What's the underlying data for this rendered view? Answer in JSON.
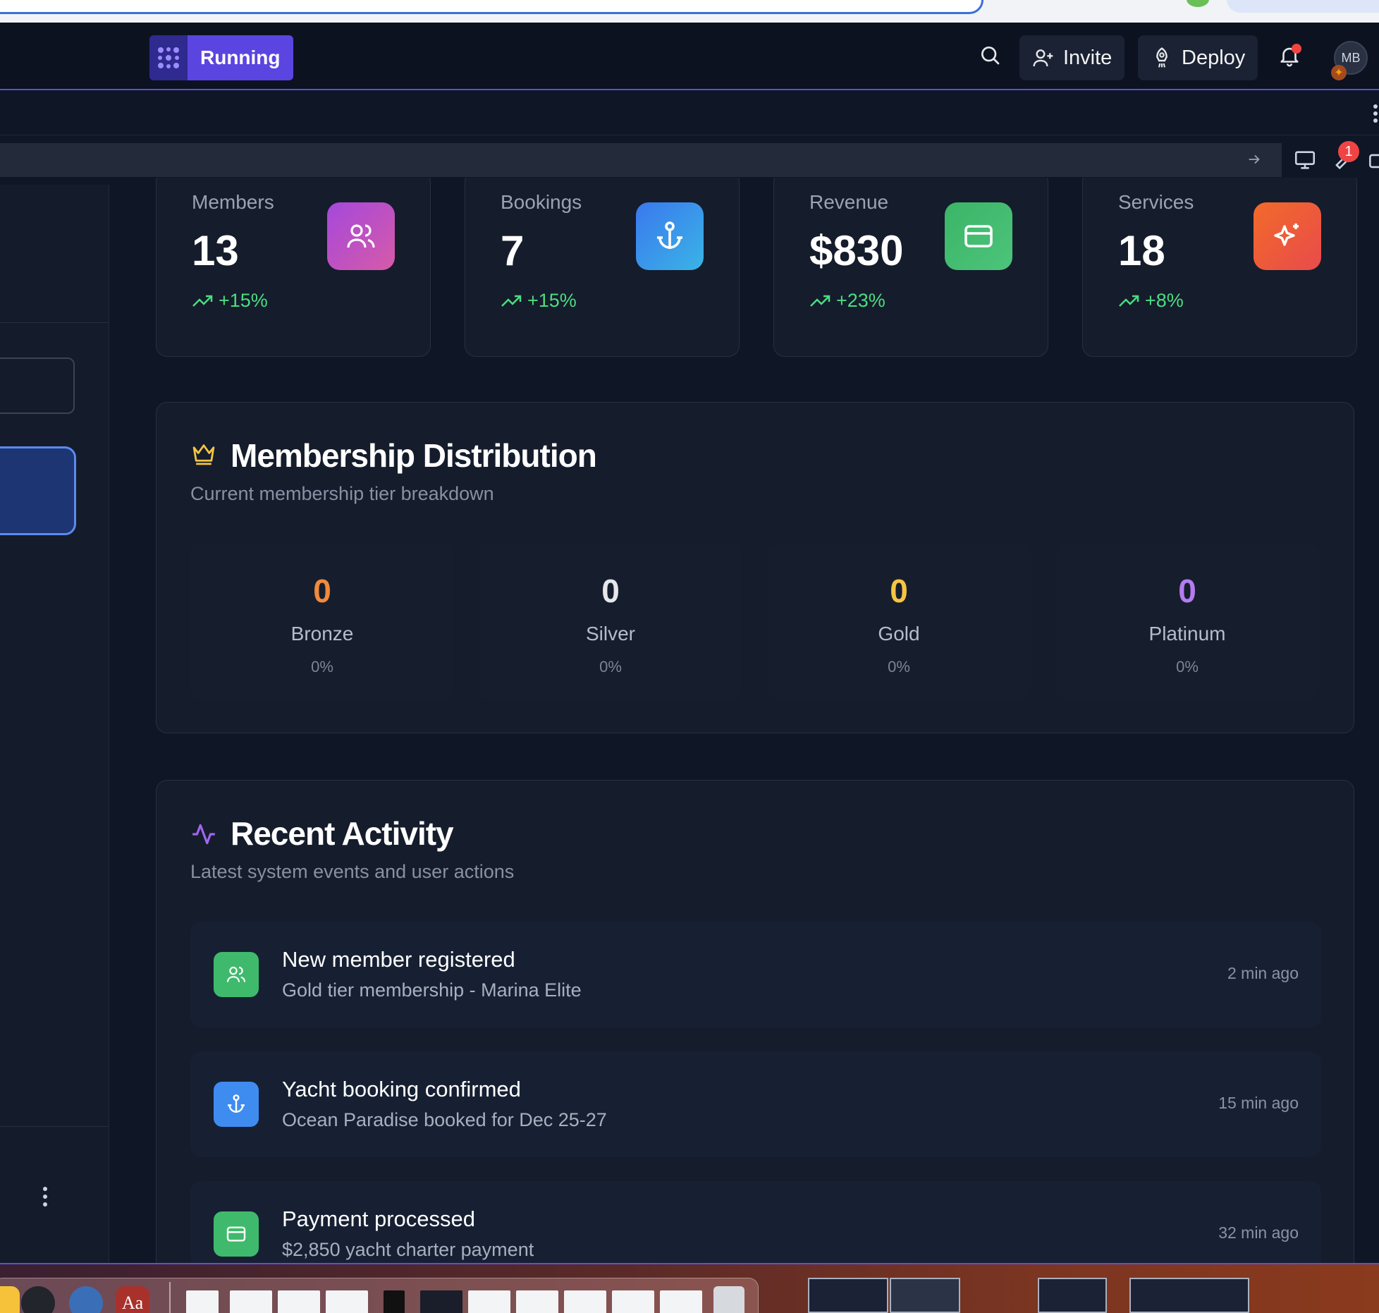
{
  "header": {
    "status_label": "Running",
    "invite_label": "Invite",
    "deploy_label": "Deploy",
    "avatar_initials": "MB"
  },
  "toolbar": {
    "badge_count": "1"
  },
  "stats": [
    {
      "label": "Members",
      "value": "13",
      "trend": "+15%",
      "icon": "users-icon",
      "color_from": "#b14fd6",
      "color_to": "#d657b0"
    },
    {
      "label": "Bookings",
      "value": "7",
      "trend": "+15%",
      "icon": "anchor-icon",
      "color_from": "#3b7ff0",
      "color_to": "#38b6e8"
    },
    {
      "label": "Revenue",
      "value": "$830",
      "trend": "+23%",
      "icon": "credit-card-icon",
      "color_from": "#3db86a",
      "color_to": "#4cc47a"
    },
    {
      "label": "Services",
      "value": "18",
      "trend": "+8%",
      "icon": "sparkles-icon",
      "color_from": "#f0652c",
      "color_to": "#e84f4a"
    }
  ],
  "membership": {
    "title": "Membership Distribution",
    "subtitle": "Current membership tier breakdown",
    "tiers": [
      {
        "count": "0",
        "name": "Bronze",
        "pct": "0%",
        "color": "#f08a3c"
      },
      {
        "count": "0",
        "name": "Silver",
        "pct": "0%",
        "color": "#e5e7eb"
      },
      {
        "count": "0",
        "name": "Gold",
        "pct": "0%",
        "color": "#f5c542"
      },
      {
        "count": "0",
        "name": "Platinum",
        "pct": "0%",
        "color": "#b47cf0"
      }
    ]
  },
  "activity": {
    "title": "Recent Activity",
    "subtitle": "Latest system events and user actions",
    "items": [
      {
        "title": "New member registered",
        "desc": "Gold tier membership - Marina Elite",
        "time": "2 min ago",
        "icon": "users-icon",
        "color": "#3fba6c"
      },
      {
        "title": "Yacht booking confirmed",
        "desc": "Ocean Paradise booked for Dec 25-27",
        "time": "15 min ago",
        "icon": "anchor-icon",
        "color": "#3f8cf0"
      },
      {
        "title": "Payment processed",
        "desc": "$2,850 yacht charter payment",
        "time": "32 min ago",
        "icon": "credit-card-icon",
        "color": "#3fba6c"
      }
    ]
  },
  "dock": {
    "dictionary_label": "Aa"
  }
}
